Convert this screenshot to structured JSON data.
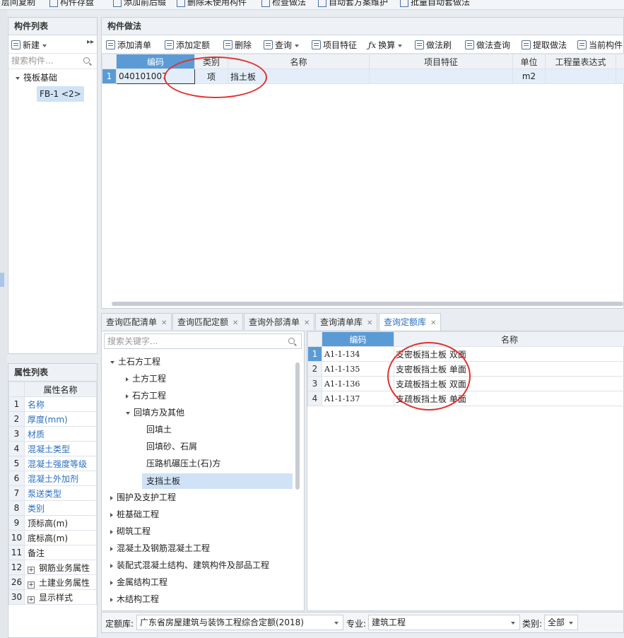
{
  "top_toolbar": {
    "items": [
      "层间复制",
      "构件存盘",
      "添加前后缀",
      "删除未使用构件",
      "检查做法",
      "自动套方案维护",
      "批量自动套做法"
    ]
  },
  "component_list": {
    "title": "构件列表",
    "new_label": "新建",
    "search_placeholder": "搜索构件...",
    "tree_root": "筏板基础",
    "tree_child": "FB-1 <2>"
  },
  "method_panel": {
    "title": "构件做法",
    "toolbar": {
      "add_list": "添加清单",
      "add_quota": "添加定额",
      "delete": "删除",
      "query": "查询",
      "features": "项目特征",
      "convert": "换算",
      "method_brush": "做法刷",
      "method_query": "做法查询",
      "extract": "提取做法",
      "current": "当前构件"
    },
    "columns": [
      "编码",
      "类别",
      "名称",
      "项目特征",
      "单位",
      "工程量表达式"
    ],
    "rows": [
      {
        "index": "1",
        "code": "040101007",
        "type": "项",
        "name": "挡土板",
        "features": "",
        "unit": "m2",
        "expr": ""
      }
    ]
  },
  "bottom_tabs": [
    "查询匹配清单",
    "查询匹配定额",
    "查询外部清单",
    "查询清单库",
    "查询定额库"
  ],
  "active_tab": "查询定额库",
  "quota_search": {
    "placeholder": "搜索关键字..."
  },
  "quota_tree": {
    "n1": "土石方工程",
    "n1_1": "土方工程",
    "n1_2": "石方工程",
    "n1_3": "回填方及其他",
    "n1_3_1": "回填土",
    "n1_3_2": "回填砂、石屑",
    "n1_3_3": "压路机碾压土(石)方",
    "n1_3_4": "支挡土板",
    "n2": "围护及支护工程",
    "n3": "桩基础工程",
    "n4": "砌筑工程",
    "n5": "混凝土及钢筋混凝土工程",
    "n6": "装配式混凝土结构、建筑构件及部品工程",
    "n7": "金属结构工程",
    "n8": "木结构工程"
  },
  "quota_table": {
    "columns": [
      "编码",
      "名称"
    ],
    "rows": [
      {
        "index": "1",
        "code": "A1-1-134",
        "name": "支密板挡土板 双面"
      },
      {
        "index": "2",
        "code": "A1-1-135",
        "name": "支密板挡土板 单面"
      },
      {
        "index": "3",
        "code": "A1-1-136",
        "name": "支疏板挡土板 双面"
      },
      {
        "index": "4",
        "code": "A1-1-137",
        "name": "支疏板挡土板 单面"
      }
    ]
  },
  "footer": {
    "quota_lib_label": "定额库:",
    "quota_lib_value": "广东省房屋建筑与装饰工程综合定额(2018)",
    "major_label": "专业:",
    "major_value": "建筑工程",
    "category_label": "类别:",
    "category_value": "全部"
  },
  "properties": {
    "title": "属性列表",
    "header": "属性名称",
    "rows": [
      {
        "n": "1",
        "name": "名称"
      },
      {
        "n": "2",
        "name": "厚度(mm)"
      },
      {
        "n": "3",
        "name": "材质"
      },
      {
        "n": "4",
        "name": "混凝土类型"
      },
      {
        "n": "5",
        "name": "混凝土强度等级"
      },
      {
        "n": "6",
        "name": "混凝土外加剂"
      },
      {
        "n": "7",
        "name": "泵送类型"
      },
      {
        "n": "8",
        "name": "类别"
      },
      {
        "n": "9",
        "name": "顶标高(m)"
      },
      {
        "n": "10",
        "name": "底标高(m)"
      },
      {
        "n": "11",
        "name": "备注"
      },
      {
        "n": "12",
        "name": "钢筋业务属性"
      },
      {
        "n": "26",
        "name": "土建业务属性"
      },
      {
        "n": "30",
        "name": "显示样式"
      }
    ]
  },
  "colors": {
    "accent": "#5b9bd5",
    "link": "#2a6fbd",
    "annotation": "#e0322f"
  }
}
